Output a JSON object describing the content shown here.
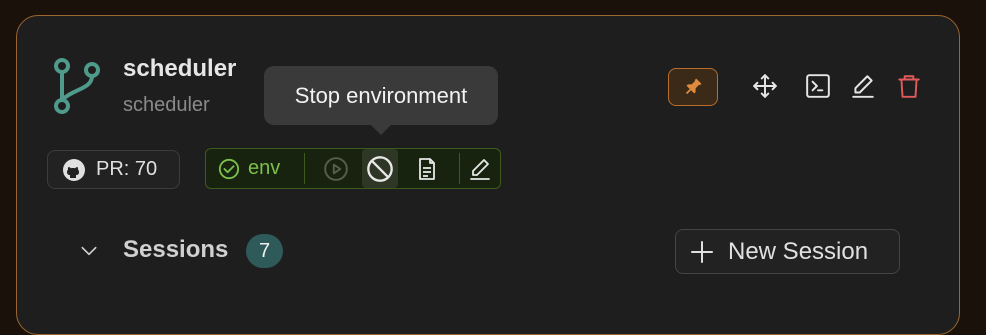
{
  "project": {
    "title": "scheduler",
    "subtitle": "scheduler"
  },
  "tooltip": {
    "text": "Stop environment"
  },
  "toolbar": {
    "pin_icon": "pin-icon",
    "move_icon": "move-icon",
    "terminal_icon": "terminal-icon",
    "edit_icon": "edit-icon",
    "delete_icon": "trash-icon"
  },
  "pr": {
    "label": "PR: 70",
    "icon": "github-icon"
  },
  "environment": {
    "status_label": "env",
    "status_icon": "check-circle-icon",
    "actions": [
      "play-icon",
      "stop-icon",
      "document-icon",
      "edit-icon"
    ]
  },
  "sessions": {
    "label": "Sessions",
    "count": "7"
  },
  "new_session": {
    "label": "New Session"
  },
  "colors": {
    "accent_border": "#9a6630",
    "pin": "#e08a3c",
    "delete": "#e05a5a",
    "env_green": "#7cc04a",
    "badge_teal": "#2f5a5a"
  }
}
